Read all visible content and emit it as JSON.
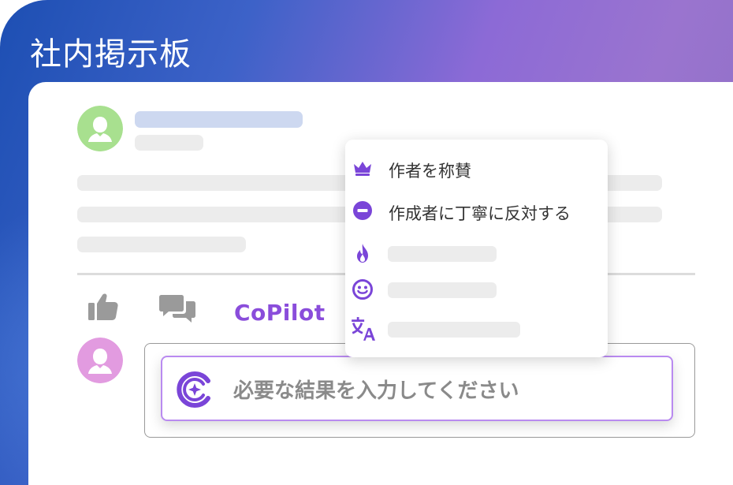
{
  "app": {
    "title": "社内掲示板"
  },
  "post": {
    "actions": {
      "copilot_label": "CoPilot"
    }
  },
  "context_menu": {
    "items": [
      {
        "icon": "crown-icon",
        "label": "作者を称賛"
      },
      {
        "icon": "minus-circle-icon",
        "label": "作成者に丁寧に反対する"
      },
      {
        "icon": "fire-icon",
        "label": ""
      },
      {
        "icon": "smile-icon",
        "label": ""
      },
      {
        "icon": "translate-icon",
        "label": ""
      }
    ]
  },
  "reply": {
    "prompt_text": "必要な結果を入力してください"
  },
  "colors": {
    "accent": "#8a4ddb",
    "prompt_border": "#b98af0",
    "author_avatar": "#a8e08f",
    "reply_avatar": "#e29be0",
    "placeholder_title": "#cdd8f0",
    "placeholder": "#ececec"
  }
}
